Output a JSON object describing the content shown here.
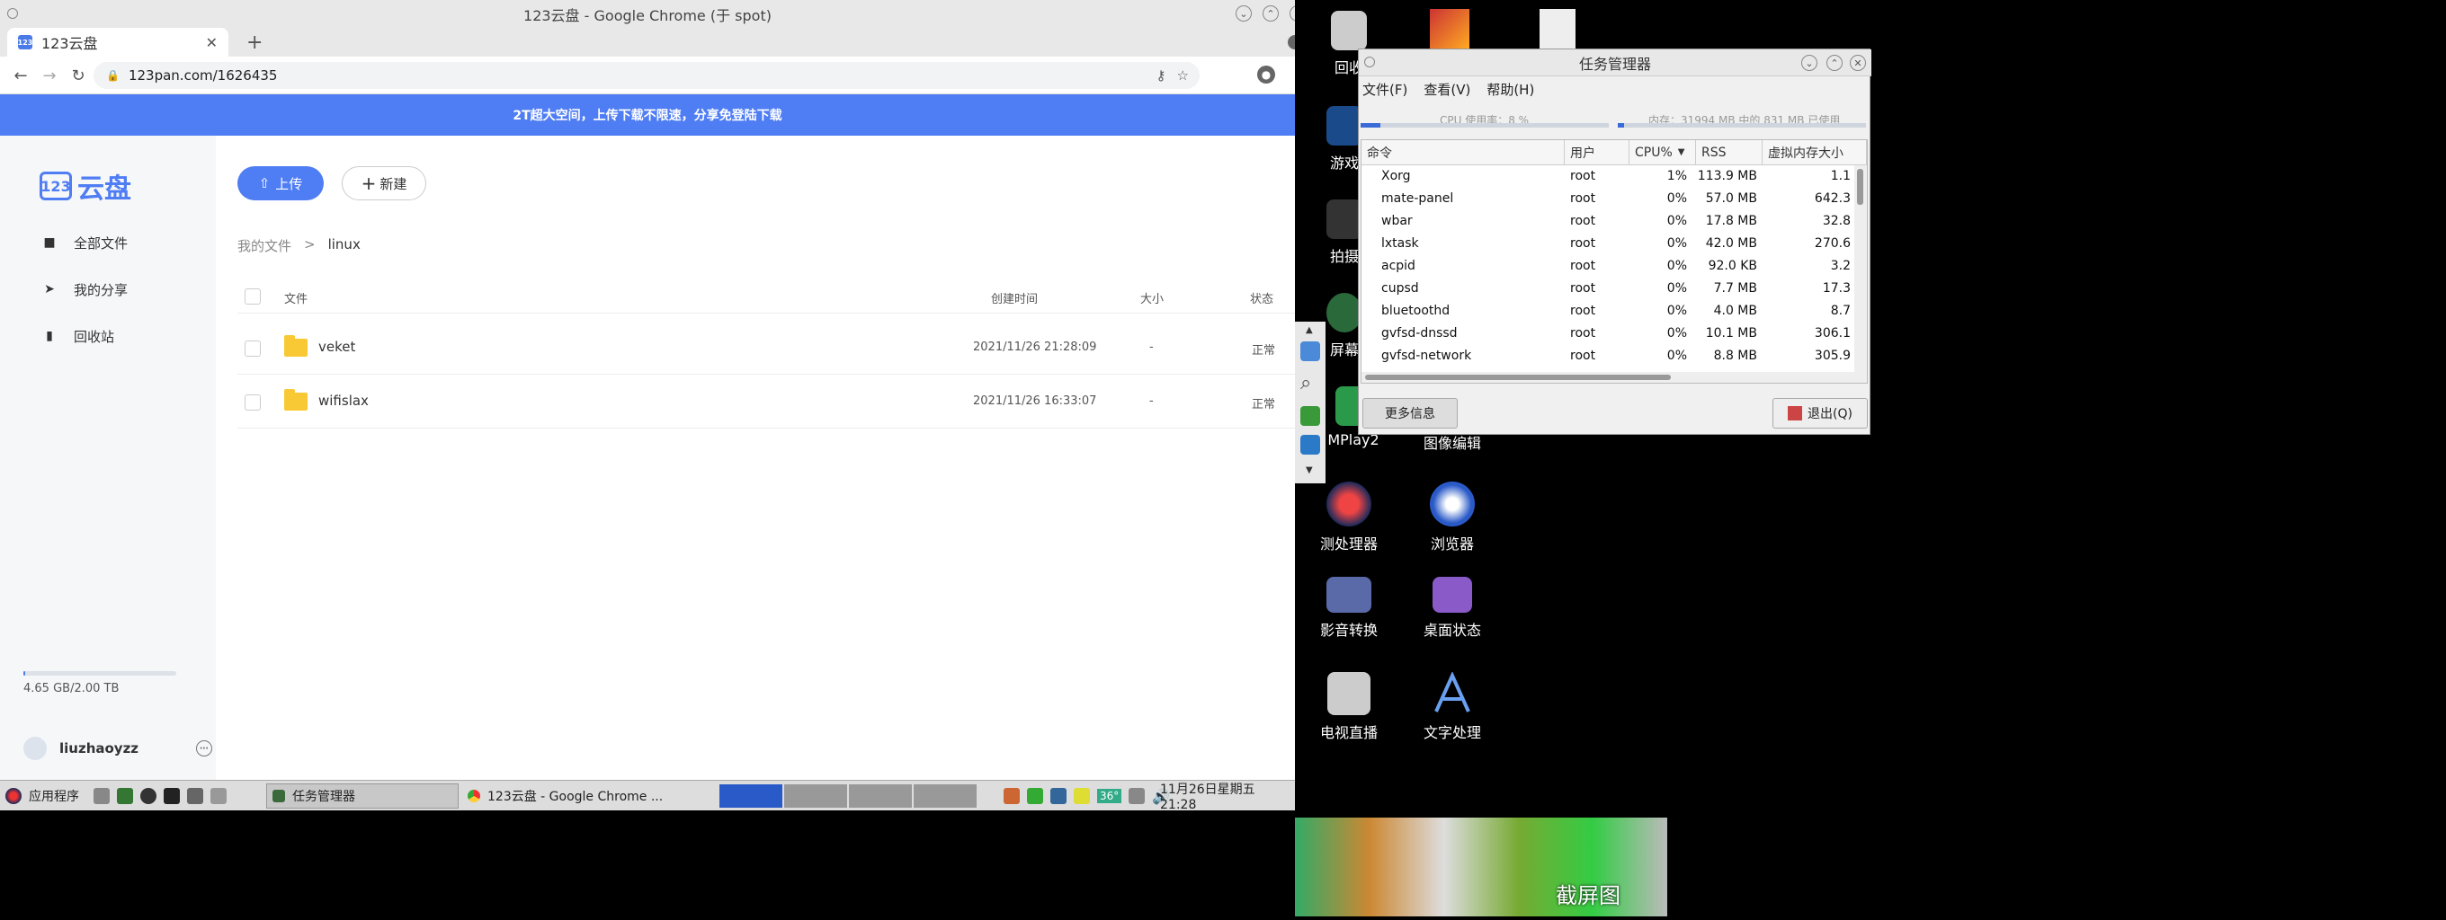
{
  "chrome": {
    "window_title": "123云盘 - Google Chrome (于 spot)",
    "tab_title": "123云盘",
    "tab_favicon": "123",
    "new_tab": "+",
    "url": "123pan.com/1626435"
  },
  "banner": {
    "text": "2T超大空间，上传下载不限速，分享免登陆下载"
  },
  "sidebar": {
    "logo_mark": "123",
    "logo_text": "云盘",
    "items": [
      {
        "label": "全部文件",
        "icon": "folder-icon"
      },
      {
        "label": "我的分享",
        "icon": "share-icon"
      },
      {
        "label": "回收站",
        "icon": "trash-icon"
      }
    ],
    "storage": "4.65 GB/2.00 TB",
    "storage_used_fraction": 0.002,
    "username": "liuzhaoyzz"
  },
  "main": {
    "upload_label": "上传",
    "new_label": "新建",
    "breadcrumb": [
      "我的文件",
      ">",
      "linux"
    ],
    "columns": {
      "name": "文件",
      "created": "创建时间",
      "size": "大小",
      "status": "状态"
    },
    "rows": [
      {
        "name": "veket",
        "created": "2021/11/26 21:28:09",
        "size": "-",
        "status": "正常"
      },
      {
        "name": "wifislax",
        "created": "2021/11/26 16:33:07",
        "size": "-",
        "status": "正常"
      }
    ]
  },
  "desktop": {
    "icons": [
      {
        "label": "回收"
      },
      {
        "label": "游戏"
      },
      {
        "label": "拍摄"
      },
      {
        "label": "屏幕"
      },
      {
        "label": "MPlay2"
      },
      {
        "label": "图像编辑"
      },
      {
        "label": "测处理器"
      },
      {
        "label": "浏览器"
      },
      {
        "label": "影音转换"
      },
      {
        "label": "桌面状态"
      },
      {
        "label": "电视直播"
      },
      {
        "label": "文字处理"
      }
    ],
    "screenshot_label": "截屏图"
  },
  "taskmgr": {
    "title": "任务管理器",
    "menu": [
      "文件(F)",
      "查看(V)",
      "帮助(H)"
    ],
    "cpu_usage": "CPU 使用率：8 %",
    "cpu_fraction": 0.08,
    "mem_usage": "内存：31994 MB 中的 831 MB 已使用",
    "mem_fraction": 0.026,
    "columns": [
      "命令",
      "用户",
      "CPU%",
      "RSS",
      "虚拟内存大小"
    ],
    "processes": [
      {
        "cmd": "Xorg",
        "user": "root",
        "cpu": "1%",
        "rss": "113.9 MB",
        "vsz": "1.1"
      },
      {
        "cmd": "mate-panel",
        "user": "root",
        "cpu": "0%",
        "rss": "57.0 MB",
        "vsz": "642.3"
      },
      {
        "cmd": "wbar",
        "user": "root",
        "cpu": "0%",
        "rss": "17.8 MB",
        "vsz": "32.8"
      },
      {
        "cmd": "lxtask",
        "user": "root",
        "cpu": "0%",
        "rss": "42.0 MB",
        "vsz": "270.6"
      },
      {
        "cmd": "acpid",
        "user": "root",
        "cpu": "0%",
        "rss": "92.0 KB",
        "vsz": "3.2"
      },
      {
        "cmd": "cupsd",
        "user": "root",
        "cpu": "0%",
        "rss": "7.7 MB",
        "vsz": "17.3"
      },
      {
        "cmd": "bluetoothd",
        "user": "root",
        "cpu": "0%",
        "rss": "4.0 MB",
        "vsz": "8.7"
      },
      {
        "cmd": "gvfsd-dnssd",
        "user": "root",
        "cpu": "0%",
        "rss": "10.1 MB",
        "vsz": "306.1"
      },
      {
        "cmd": "gvfsd-network",
        "user": "root",
        "cpu": "0%",
        "rss": "8.8 MB",
        "vsz": "305.9"
      }
    ],
    "more_info": "更多信息",
    "quit": "退出(Q)"
  },
  "taskbar": {
    "apps_menu": "应用程序",
    "task1": "任务管理器",
    "task2": "123云盘 - Google Chrome ...",
    "temp": "36°",
    "clock": "11月26日星期五 21:28"
  }
}
